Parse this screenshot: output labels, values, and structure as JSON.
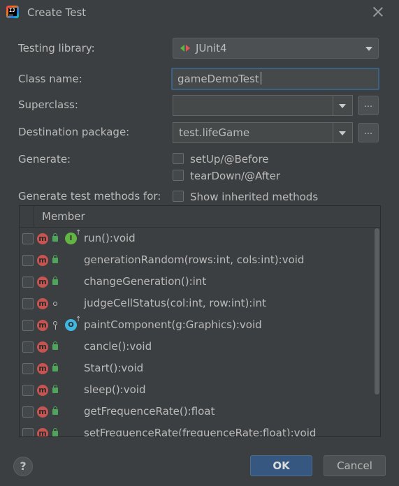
{
  "window": {
    "title": "Create Test",
    "app_icon_letters": "IJ"
  },
  "form": {
    "testing_library": {
      "label": "Testing library:",
      "value": "JUnit4"
    },
    "class_name": {
      "label": "Class name:",
      "value": "gameDemoTest"
    },
    "superclass": {
      "label": "Superclass:",
      "value": "",
      "browse_label": "..."
    },
    "destination_package": {
      "label": "Destination package:",
      "value": "test.lifeGame",
      "browse_label": "..."
    },
    "generate": {
      "label": "Generate:",
      "options": [
        "setUp/@Before",
        "tearDown/@After"
      ]
    },
    "generate_methods": {
      "label": "Generate test methods for:",
      "show_inherited_label": "Show inherited methods"
    }
  },
  "table": {
    "header": "Member",
    "rows": [
      {
        "member": "run():void",
        "visibility": "public",
        "badge": "implements"
      },
      {
        "member": "generationRandom(rows:int, cols:int):void",
        "visibility": "public",
        "badge": ""
      },
      {
        "member": "changeGeneration():int",
        "visibility": "public",
        "badge": ""
      },
      {
        "member": "judgeCellStatus(col:int, row:int):int",
        "visibility": "package",
        "badge": ""
      },
      {
        "member": "paintComponent(g:Graphics):void",
        "visibility": "protected",
        "badge": "overrides"
      },
      {
        "member": "cancle():void",
        "visibility": "public",
        "badge": ""
      },
      {
        "member": "Start():void",
        "visibility": "public",
        "badge": ""
      },
      {
        "member": "sleep():void",
        "visibility": "public",
        "badge": ""
      },
      {
        "member": "getFrequenceRate():float",
        "visibility": "public",
        "badge": ""
      },
      {
        "member": "setFrequenceRate(frequenceRate:float):void",
        "visibility": "public",
        "badge": ""
      }
    ],
    "method_icon_letter": "m",
    "implements_icon_letter": "I",
    "overrides_icon_letter": "O"
  },
  "buttons": {
    "help": "?",
    "ok": "OK",
    "cancel": "Cancel"
  },
  "colors": {
    "background": "#3c3f41",
    "field": "#45494a",
    "focus": "#3d6185",
    "ok_button": "#365880",
    "method_icon": "#c75450",
    "public_lock": "#4fa55b"
  }
}
